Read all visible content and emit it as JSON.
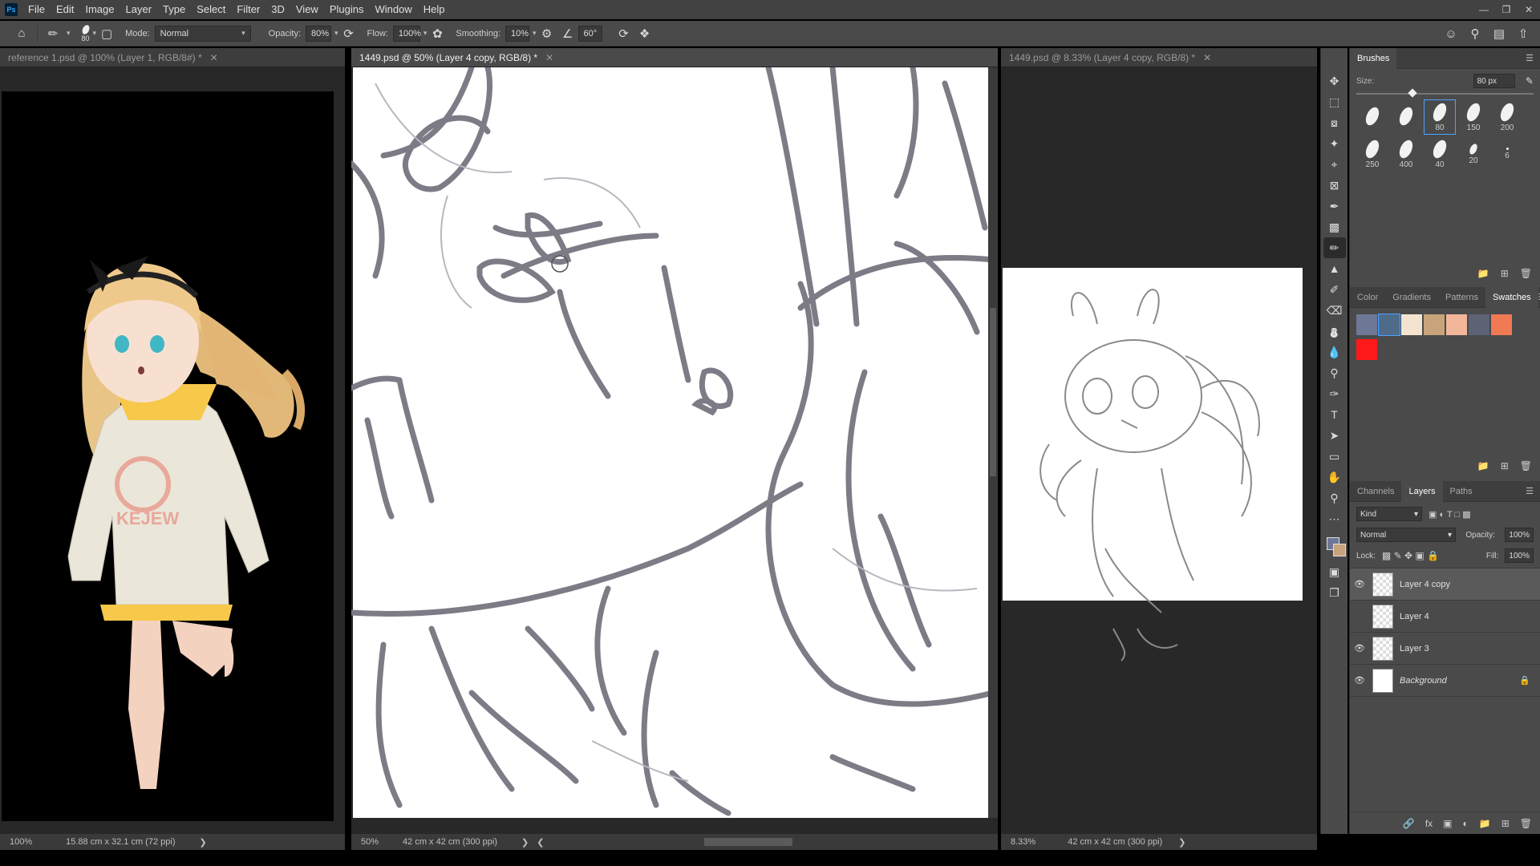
{
  "app": {
    "logo": "Ps"
  },
  "menu": [
    "File",
    "Edit",
    "Image",
    "Layer",
    "Type",
    "Select",
    "Filter",
    "3D",
    "View",
    "Plugins",
    "Window",
    "Help"
  ],
  "options": {
    "brush_size": "80",
    "mode_label": "Mode:",
    "mode_value": "Normal",
    "opacity_label": "Opacity:",
    "opacity_value": "80%",
    "flow_label": "Flow:",
    "flow_value": "100%",
    "smoothing_label": "Smoothing:",
    "smoothing_value": "10%",
    "angle_value": "60°"
  },
  "docs": {
    "left": {
      "tab": "reference 1.psd @ 100% (Layer 1, RGB/8#) *",
      "zoom": "100%",
      "info": "15.88 cm x 32.1 cm (72 ppi)"
    },
    "center": {
      "tab": "1449.psd @ 50% (Layer 4 copy, RGB/8) *",
      "zoom": "50%",
      "info": "42 cm x 42 cm (300 ppi)"
    },
    "right": {
      "tab": "1449.psd @ 8.33% (Layer 4 copy, RGB/8) *",
      "zoom": "8.33%",
      "info": "42 cm x 42 cm (300 ppi)"
    }
  },
  "artwork": {
    "hoodie_text": "KEJEW"
  },
  "brushes": {
    "tab": "Brushes",
    "size_label": "Size:",
    "size_value": "80 px",
    "presets": [
      "",
      "",
      "80",
      "150",
      "200",
      "250",
      "400",
      "40",
      "20",
      "6"
    ]
  },
  "colors_panel": {
    "tabs": [
      "Color",
      "Gradients",
      "Patterns",
      "Swatches"
    ],
    "swatches": [
      "#6e7796",
      "#4f6b8a",
      "#f4e4cf",
      "#c9a37c",
      "#f2b79a",
      "#5d6275",
      "#f07a54",
      "#ff1a1a"
    ]
  },
  "layers_panel": {
    "tabs": [
      "Channels",
      "Layers",
      "Paths"
    ],
    "filter_kind": "Kind",
    "blend_mode": "Normal",
    "opacity_label": "Opacity:",
    "opacity_value": "100%",
    "lock_label": "Lock:",
    "fill_label": "Fill:",
    "fill_value": "100%",
    "layers": [
      {
        "name": "Layer 4 copy",
        "visible": true
      },
      {
        "name": "Layer 4",
        "visible": false
      },
      {
        "name": "Layer 3",
        "visible": true
      },
      {
        "name": "Background",
        "visible": true
      }
    ]
  }
}
